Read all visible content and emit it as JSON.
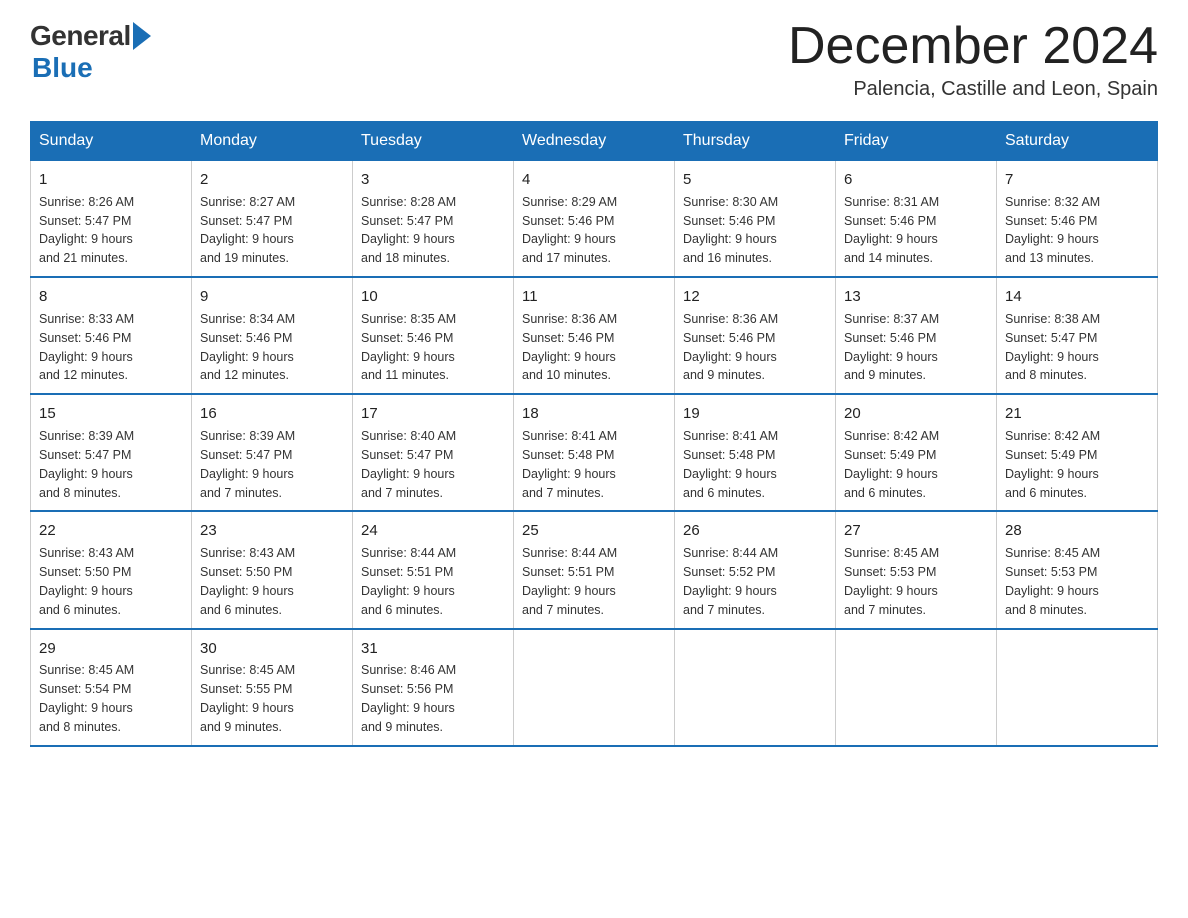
{
  "logo": {
    "general": "General",
    "blue": "Blue"
  },
  "title": "December 2024",
  "subtitle": "Palencia, Castille and Leon, Spain",
  "days_of_week": [
    "Sunday",
    "Monday",
    "Tuesday",
    "Wednesday",
    "Thursday",
    "Friday",
    "Saturday"
  ],
  "weeks": [
    [
      {
        "day": "1",
        "info": "Sunrise: 8:26 AM\nSunset: 5:47 PM\nDaylight: 9 hours\nand 21 minutes."
      },
      {
        "day": "2",
        "info": "Sunrise: 8:27 AM\nSunset: 5:47 PM\nDaylight: 9 hours\nand 19 minutes."
      },
      {
        "day": "3",
        "info": "Sunrise: 8:28 AM\nSunset: 5:47 PM\nDaylight: 9 hours\nand 18 minutes."
      },
      {
        "day": "4",
        "info": "Sunrise: 8:29 AM\nSunset: 5:46 PM\nDaylight: 9 hours\nand 17 minutes."
      },
      {
        "day": "5",
        "info": "Sunrise: 8:30 AM\nSunset: 5:46 PM\nDaylight: 9 hours\nand 16 minutes."
      },
      {
        "day": "6",
        "info": "Sunrise: 8:31 AM\nSunset: 5:46 PM\nDaylight: 9 hours\nand 14 minutes."
      },
      {
        "day": "7",
        "info": "Sunrise: 8:32 AM\nSunset: 5:46 PM\nDaylight: 9 hours\nand 13 minutes."
      }
    ],
    [
      {
        "day": "8",
        "info": "Sunrise: 8:33 AM\nSunset: 5:46 PM\nDaylight: 9 hours\nand 12 minutes."
      },
      {
        "day": "9",
        "info": "Sunrise: 8:34 AM\nSunset: 5:46 PM\nDaylight: 9 hours\nand 12 minutes."
      },
      {
        "day": "10",
        "info": "Sunrise: 8:35 AM\nSunset: 5:46 PM\nDaylight: 9 hours\nand 11 minutes."
      },
      {
        "day": "11",
        "info": "Sunrise: 8:36 AM\nSunset: 5:46 PM\nDaylight: 9 hours\nand 10 minutes."
      },
      {
        "day": "12",
        "info": "Sunrise: 8:36 AM\nSunset: 5:46 PM\nDaylight: 9 hours\nand 9 minutes."
      },
      {
        "day": "13",
        "info": "Sunrise: 8:37 AM\nSunset: 5:46 PM\nDaylight: 9 hours\nand 9 minutes."
      },
      {
        "day": "14",
        "info": "Sunrise: 8:38 AM\nSunset: 5:47 PM\nDaylight: 9 hours\nand 8 minutes."
      }
    ],
    [
      {
        "day": "15",
        "info": "Sunrise: 8:39 AM\nSunset: 5:47 PM\nDaylight: 9 hours\nand 8 minutes."
      },
      {
        "day": "16",
        "info": "Sunrise: 8:39 AM\nSunset: 5:47 PM\nDaylight: 9 hours\nand 7 minutes."
      },
      {
        "day": "17",
        "info": "Sunrise: 8:40 AM\nSunset: 5:47 PM\nDaylight: 9 hours\nand 7 minutes."
      },
      {
        "day": "18",
        "info": "Sunrise: 8:41 AM\nSunset: 5:48 PM\nDaylight: 9 hours\nand 7 minutes."
      },
      {
        "day": "19",
        "info": "Sunrise: 8:41 AM\nSunset: 5:48 PM\nDaylight: 9 hours\nand 6 minutes."
      },
      {
        "day": "20",
        "info": "Sunrise: 8:42 AM\nSunset: 5:49 PM\nDaylight: 9 hours\nand 6 minutes."
      },
      {
        "day": "21",
        "info": "Sunrise: 8:42 AM\nSunset: 5:49 PM\nDaylight: 9 hours\nand 6 minutes."
      }
    ],
    [
      {
        "day": "22",
        "info": "Sunrise: 8:43 AM\nSunset: 5:50 PM\nDaylight: 9 hours\nand 6 minutes."
      },
      {
        "day": "23",
        "info": "Sunrise: 8:43 AM\nSunset: 5:50 PM\nDaylight: 9 hours\nand 6 minutes."
      },
      {
        "day": "24",
        "info": "Sunrise: 8:44 AM\nSunset: 5:51 PM\nDaylight: 9 hours\nand 6 minutes."
      },
      {
        "day": "25",
        "info": "Sunrise: 8:44 AM\nSunset: 5:51 PM\nDaylight: 9 hours\nand 7 minutes."
      },
      {
        "day": "26",
        "info": "Sunrise: 8:44 AM\nSunset: 5:52 PM\nDaylight: 9 hours\nand 7 minutes."
      },
      {
        "day": "27",
        "info": "Sunrise: 8:45 AM\nSunset: 5:53 PM\nDaylight: 9 hours\nand 7 minutes."
      },
      {
        "day": "28",
        "info": "Sunrise: 8:45 AM\nSunset: 5:53 PM\nDaylight: 9 hours\nand 8 minutes."
      }
    ],
    [
      {
        "day": "29",
        "info": "Sunrise: 8:45 AM\nSunset: 5:54 PM\nDaylight: 9 hours\nand 8 minutes."
      },
      {
        "day": "30",
        "info": "Sunrise: 8:45 AM\nSunset: 5:55 PM\nDaylight: 9 hours\nand 9 minutes."
      },
      {
        "day": "31",
        "info": "Sunrise: 8:46 AM\nSunset: 5:56 PM\nDaylight: 9 hours\nand 9 minutes."
      },
      null,
      null,
      null,
      null
    ]
  ]
}
